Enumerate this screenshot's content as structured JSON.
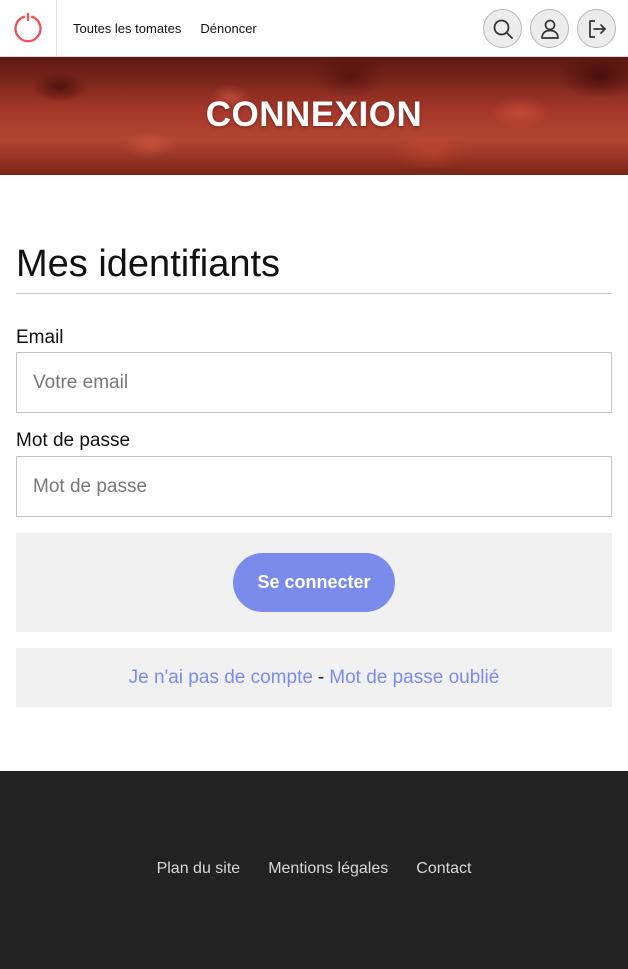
{
  "header": {
    "nav": [
      "Toutes les tomates",
      "Dénoncer"
    ],
    "icons": [
      "search-icon",
      "user-icon",
      "logout-icon"
    ]
  },
  "banner": {
    "title": "CONNEXION"
  },
  "form": {
    "heading": "Mes identifiants",
    "email_label": "Email",
    "email_placeholder": "Votre email",
    "email_value": "",
    "password_label": "Mot de passe",
    "password_placeholder": "Mot de passe",
    "password_value": "",
    "submit_label": "Se connecter"
  },
  "links": {
    "no_account": "Je n'ai pas de compte",
    "separator": "-",
    "forgot": "Mot de passe oublié"
  },
  "footer": {
    "links": [
      "Plan du site",
      "Mentions légales",
      "Contact"
    ]
  },
  "colors": {
    "accent": "#7b8beb",
    "logo": "#e8555a",
    "footer_bg": "#222222",
    "panel_bg": "#f1f1f1"
  }
}
